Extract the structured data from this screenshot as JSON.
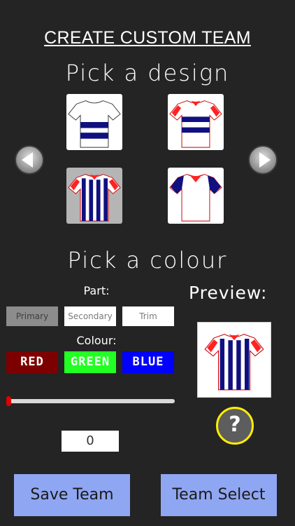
{
  "title": "CREATE CUSTOM TEAM",
  "design_heading": "Pick a design",
  "colour_heading": "Pick a colour",
  "designs": [
    {
      "icon": "shirt-white-blue-hoops-icon",
      "selected": false
    },
    {
      "icon": "shirt-red-trim-blue-hoops-icon",
      "selected": false
    },
    {
      "icon": "shirt-blue-stripes-icon",
      "selected": true
    },
    {
      "icon": "shirt-white-blue-sleeves-icon",
      "selected": false
    }
  ],
  "nav": {
    "prev_icon": "arrow-left-icon",
    "next_icon": "arrow-right-icon"
  },
  "part_label": "Part:",
  "parts": [
    "Primary",
    "Secondary",
    "Trim"
  ],
  "selected_part": "Primary",
  "colour_label": "Colour:",
  "colours": [
    {
      "label": "RED",
      "color": "#7d0000"
    },
    {
      "label": "GREEN",
      "color": "#22ff22"
    },
    {
      "label": "BLUE",
      "color": "#0000ff"
    }
  ],
  "slider_level": 0,
  "value": "0",
  "preview_label": "Preview:",
  "preview_icon": "shirt-blue-stripes-icon",
  "help": {
    "icon": "question-mark-icon",
    "glyph": "?"
  },
  "buttons": {
    "save": "Save Team",
    "select": "Team Select"
  }
}
